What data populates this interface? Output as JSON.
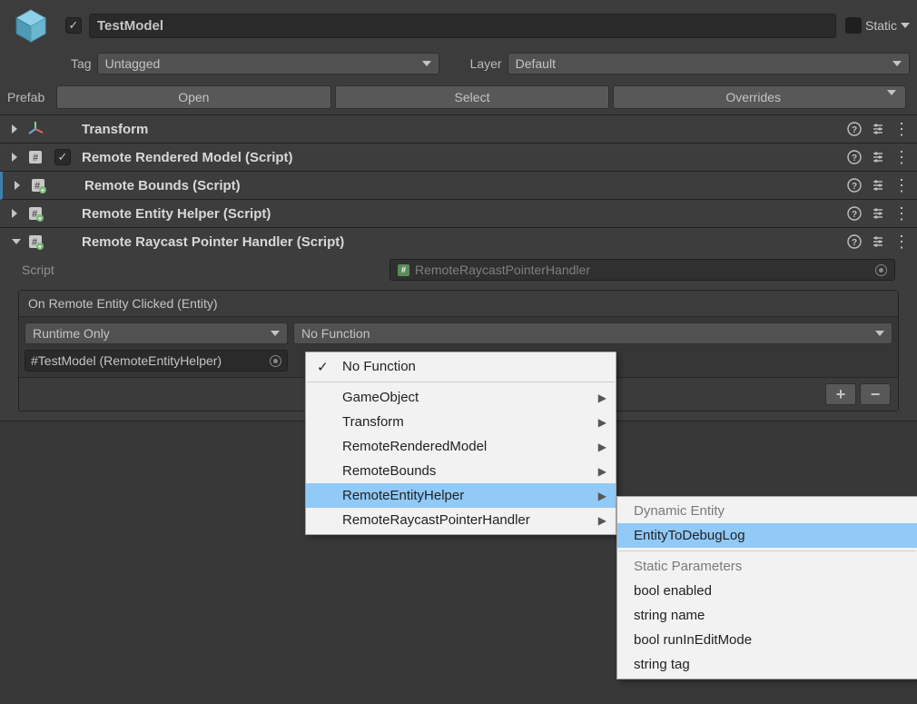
{
  "object": {
    "name": "TestModel",
    "active": true,
    "static_label": "Static",
    "static_checked": false
  },
  "tag_label": "Tag",
  "tag_value": "Untagged",
  "layer_label": "Layer",
  "layer_value": "Default",
  "prefab": {
    "label": "Prefab",
    "open": "Open",
    "select": "Select",
    "overrides": "Overrides"
  },
  "components": [
    {
      "title": "Transform",
      "has_checkbox": false,
      "icon": "transform-axes-icon",
      "expanded": false
    },
    {
      "title": "Remote Rendered Model (Script)",
      "has_checkbox": true,
      "checked": true,
      "icon": "script-icon",
      "expanded": false
    },
    {
      "title": "Remote Bounds (Script)",
      "has_checkbox": false,
      "icon": "script-new-icon",
      "expanded": false,
      "selected": true
    },
    {
      "title": "Remote Entity Helper (Script)",
      "has_checkbox": false,
      "icon": "script-new-icon",
      "expanded": false
    },
    {
      "title": "Remote Raycast Pointer Handler (Script)",
      "has_checkbox": false,
      "icon": "script-new-icon",
      "expanded": true
    }
  ],
  "raycast": {
    "script_label": "Script",
    "script_value": "RemoteRaycastPointerHandler",
    "event_title": "On Remote Entity Clicked (Entity)",
    "call_mode": "Runtime Only",
    "function": "No Function",
    "target": "TestModel (RemoteEntityHelper)"
  },
  "menu1": {
    "items": [
      {
        "label": "No Function",
        "checked": true,
        "submenu": false
      },
      {
        "sep": true
      },
      {
        "label": "GameObject",
        "submenu": true
      },
      {
        "label": "Transform",
        "submenu": true
      },
      {
        "label": "RemoteRenderedModel",
        "submenu": true
      },
      {
        "label": "RemoteBounds",
        "submenu": true
      },
      {
        "label": "RemoteEntityHelper",
        "submenu": true,
        "highlight": true
      },
      {
        "label": "RemoteRaycastPointerHandler",
        "submenu": true
      }
    ]
  },
  "menu2": {
    "header1": "Dynamic Entity",
    "hl_item": "EntityToDebugLog",
    "header2": "Static Parameters",
    "items": [
      "bool enabled",
      "string name",
      "bool runInEditMode",
      "string tag"
    ]
  },
  "icons": {
    "help": "?",
    "preset": "⚙",
    "dots": "⋮",
    "plus": "+",
    "minus": "−"
  }
}
